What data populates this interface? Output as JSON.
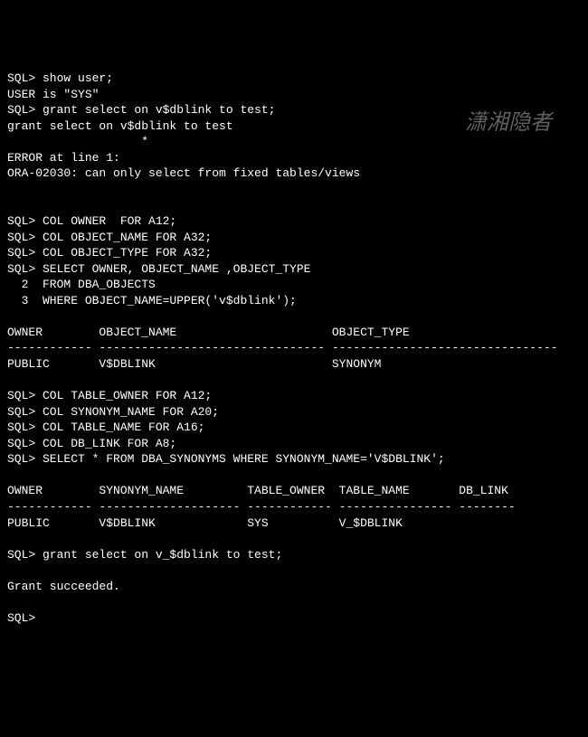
{
  "lines": [
    "SQL> show user;",
    "USER is \"SYS\"",
    "SQL> grant select on v$dblink to test;",
    "grant select on v$dblink to test",
    "                   *",
    "ERROR at line 1:",
    "ORA-02030: can only select from fixed tables/views",
    "",
    "",
    "SQL> COL OWNER  FOR A12;",
    "SQL> COL OBJECT_NAME FOR A32;",
    "SQL> COL OBJECT_TYPE FOR A32;",
    "SQL> SELECT OWNER, OBJECT_NAME ,OBJECT_TYPE",
    "  2  FROM DBA_OBJECTS",
    "  3  WHERE OBJECT_NAME=UPPER('v$dblink');",
    "",
    "OWNER        OBJECT_NAME                      OBJECT_TYPE",
    "------------ -------------------------------- --------------------------------",
    "PUBLIC       V$DBLINK                         SYNONYM",
    "",
    "SQL> COL TABLE_OWNER FOR A12;",
    "SQL> COL SYNONYM_NAME FOR A20;",
    "SQL> COL TABLE_NAME FOR A16;",
    "SQL> COL DB_LINK FOR A8;",
    "SQL> SELECT * FROM DBA_SYNONYMS WHERE SYNONYM_NAME='V$DBLINK';",
    "",
    "OWNER        SYNONYM_NAME         TABLE_OWNER  TABLE_NAME       DB_LINK",
    "------------ -------------------- ------------ ---------------- --------",
    "PUBLIC       V$DBLINK             SYS          V_$DBLINK",
    "",
    "SQL> grant select on v_$dblink to test;",
    "",
    "Grant succeeded.",
    "",
    "SQL>"
  ],
  "watermark": "潇湘隐者"
}
